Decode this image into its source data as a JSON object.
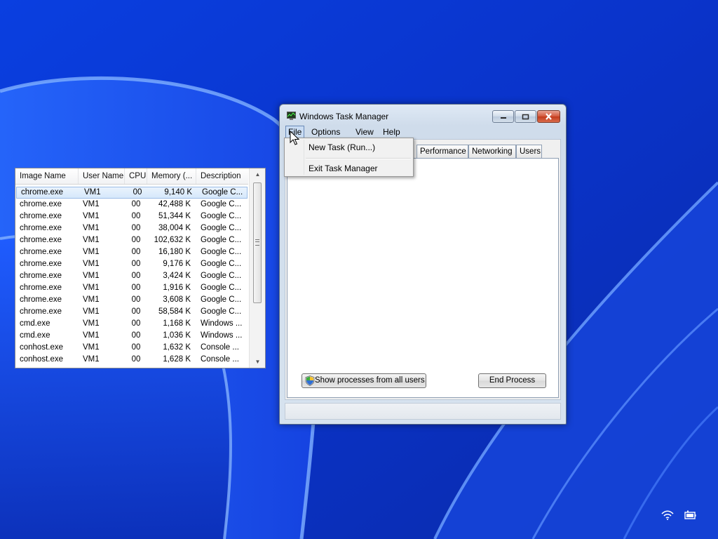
{
  "window": {
    "title": "Windows Task Manager"
  },
  "menubar": {
    "file": "File",
    "options": "Options",
    "view": "View",
    "help": "Help"
  },
  "file_menu": {
    "new_task": "New Task (Run...)",
    "exit": "Exit Task Manager"
  },
  "tabs": {
    "performance": "Performance",
    "networking": "Networking",
    "users": "Users"
  },
  "columns": {
    "image_name": "Image Name",
    "user_name": "User Name",
    "cpu": "CPU",
    "memory": "Memory (...",
    "description": "Description"
  },
  "processes": [
    {
      "name": "chrome.exe",
      "user": "VM1",
      "cpu": "00",
      "memory": "9,140 K",
      "description": "Google C..."
    },
    {
      "name": "chrome.exe",
      "user": "VM1",
      "cpu": "00",
      "memory": "42,488 K",
      "description": "Google C..."
    },
    {
      "name": "chrome.exe",
      "user": "VM1",
      "cpu": "00",
      "memory": "51,344 K",
      "description": "Google C..."
    },
    {
      "name": "chrome.exe",
      "user": "VM1",
      "cpu": "00",
      "memory": "38,004 K",
      "description": "Google C..."
    },
    {
      "name": "chrome.exe",
      "user": "VM1",
      "cpu": "00",
      "memory": "102,632 K",
      "description": "Google C..."
    },
    {
      "name": "chrome.exe",
      "user": "VM1",
      "cpu": "00",
      "memory": "16,180 K",
      "description": "Google C..."
    },
    {
      "name": "chrome.exe",
      "user": "VM1",
      "cpu": "00",
      "memory": "9,176 K",
      "description": "Google C..."
    },
    {
      "name": "chrome.exe",
      "user": "VM1",
      "cpu": "00",
      "memory": "3,424 K",
      "description": "Google C..."
    },
    {
      "name": "chrome.exe",
      "user": "VM1",
      "cpu": "00",
      "memory": "1,916 K",
      "description": "Google C..."
    },
    {
      "name": "chrome.exe",
      "user": "VM1",
      "cpu": "00",
      "memory": "3,608 K",
      "description": "Google C..."
    },
    {
      "name": "chrome.exe",
      "user": "VM1",
      "cpu": "00",
      "memory": "58,584 K",
      "description": "Google C..."
    },
    {
      "name": "cmd.exe",
      "user": "VM1",
      "cpu": "00",
      "memory": "1,168 K",
      "description": "Windows ..."
    },
    {
      "name": "cmd.exe",
      "user": "VM1",
      "cpu": "00",
      "memory": "1,036 K",
      "description": "Windows ..."
    },
    {
      "name": "conhost.exe",
      "user": "VM1",
      "cpu": "00",
      "memory": "1,632 K",
      "description": "Console ..."
    },
    {
      "name": "conhost.exe",
      "user": "VM1",
      "cpu": "00",
      "memory": "1,628 K",
      "description": "Console ..."
    }
  ],
  "buttons": {
    "show_all": "Show processes from all users",
    "end_process": "End Process"
  },
  "icons": {
    "app": "task-manager-icon",
    "shield": "uac-shield-icon",
    "wifi": "wifi-icon",
    "battery": "battery-icon"
  }
}
